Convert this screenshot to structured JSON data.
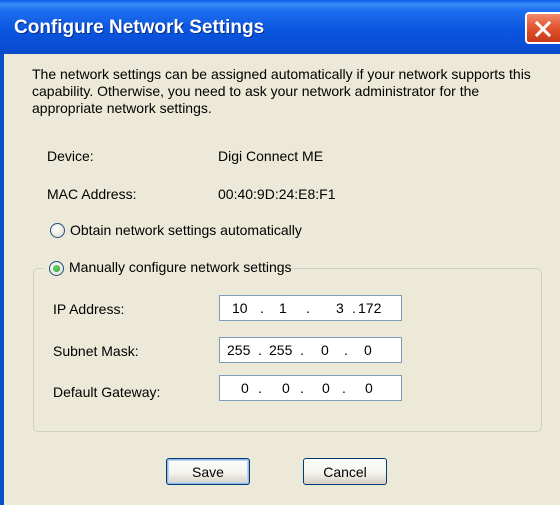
{
  "window": {
    "title": "Configure Network Settings",
    "close_icon": "close-icon (white X on red)"
  },
  "description": "The network settings can be assigned automatically if your network supports this capability. Otherwise, you need to ask your network administrator for the appropriate network settings.",
  "device": {
    "label": "Device:",
    "value": "Digi Connect ME"
  },
  "mac": {
    "label": "MAC Address:",
    "value": "00:40:9D:24:E8:F1"
  },
  "options": {
    "auto": {
      "label": "Obtain network settings automatically",
      "selected": false
    },
    "manual": {
      "label": "Manually configure network settings",
      "selected": true
    }
  },
  "fields": {
    "ip": {
      "label": "IP Address:",
      "octets": [
        "10",
        "1",
        "3",
        "172"
      ]
    },
    "subnet": {
      "label": "Subnet Mask:",
      "octets": [
        "255",
        "255",
        "0",
        "0"
      ]
    },
    "gateway": {
      "label": "Default Gateway:",
      "octets": [
        "0",
        "0",
        "0",
        "0"
      ]
    }
  },
  "buttons": {
    "save": "Save",
    "cancel": "Cancel"
  },
  "colors": {
    "titlebar": "#0a55df",
    "dialog_bg": "#ece9d8",
    "close_button": "#e2532f",
    "radio_dot": "#21a121"
  }
}
